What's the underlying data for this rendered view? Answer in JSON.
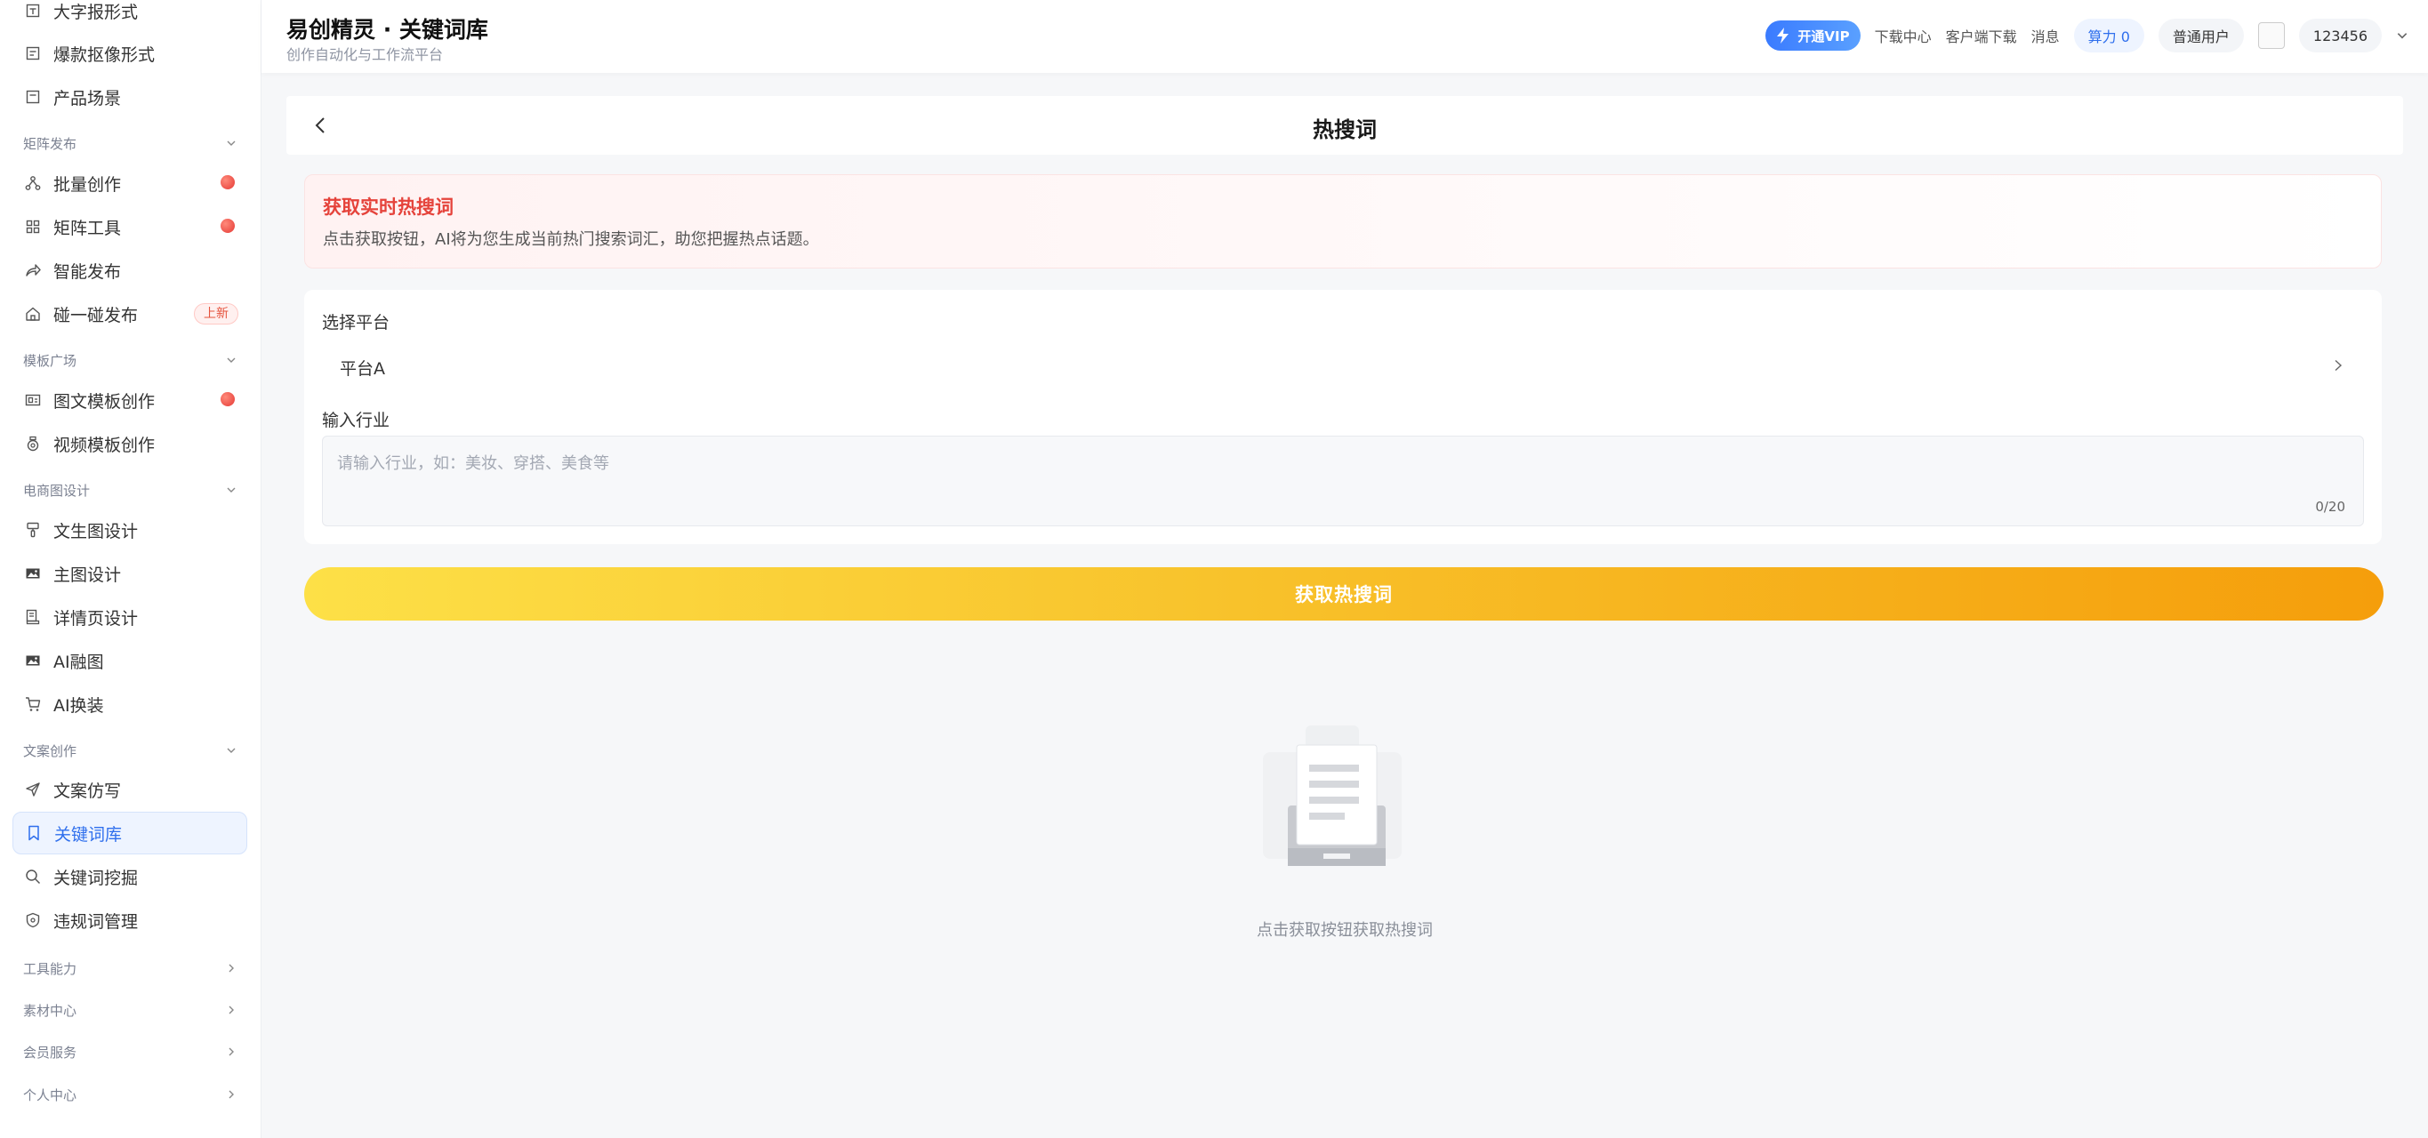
{
  "header": {
    "title": "易创精灵 · 关键词库",
    "subtitle": "创作自动化与工作流平台",
    "vip_label": "开通VIP",
    "download_center": "下载中心",
    "client_download": "客户端下载",
    "messages": "消息",
    "compute": "算力 0",
    "user_type": "普通用户",
    "username": "123456"
  },
  "sidebar": {
    "items_top": [
      {
        "label": "大字报形式",
        "icon": "text-poster-icon"
      },
      {
        "label": "爆款抠像形式",
        "icon": "cutout-icon"
      },
      {
        "label": "产品场景",
        "icon": "scene-icon"
      }
    ],
    "groups": [
      {
        "label": "矩阵发布",
        "expanded": true,
        "items": [
          {
            "label": "批量创作",
            "icon": "sitemap-icon",
            "badge": "hot"
          },
          {
            "label": "矩阵工具",
            "icon": "grid-icon",
            "badge": "hot"
          },
          {
            "label": "智能发布",
            "icon": "share-icon"
          },
          {
            "label": "碰一碰发布",
            "icon": "home-icon",
            "badge_text": "上新"
          }
        ]
      },
      {
        "label": "模板广场",
        "expanded": true,
        "items": [
          {
            "label": "图文模板创作",
            "icon": "image-text-icon",
            "badge": "hot"
          },
          {
            "label": "视频模板创作",
            "icon": "video-template-icon"
          }
        ]
      },
      {
        "label": "电商图设计",
        "expanded": true,
        "items": [
          {
            "label": "文生图设计",
            "icon": "brush-icon"
          },
          {
            "label": "主图设计",
            "icon": "picture-icon"
          },
          {
            "label": "详情页设计",
            "icon": "detail-page-icon"
          },
          {
            "label": "AI融图",
            "icon": "fusion-icon"
          },
          {
            "label": "AI换装",
            "icon": "cart-icon"
          }
        ]
      },
      {
        "label": "文案创作",
        "expanded": true,
        "items": [
          {
            "label": "文案仿写",
            "icon": "send-icon"
          },
          {
            "label": "关键词库",
            "icon": "bookmark-icon",
            "active": true
          },
          {
            "label": "关键词挖掘",
            "icon": "search-icon"
          },
          {
            "label": "违规词管理",
            "icon": "shield-icon"
          }
        ]
      }
    ],
    "collapsed_groups": [
      "工具能力",
      "素材中心",
      "会员服务",
      "个人中心"
    ]
  },
  "main": {
    "page_title": "热搜词",
    "info_title": "获取实时热搜词",
    "info_desc": "点击获取按钮，AI将为您生成当前热门搜索词汇，助您把握热点话题。",
    "platform_label": "选择平台",
    "platform_value": "平台A",
    "industry_label": "输入行业",
    "industry_value": "",
    "industry_placeholder": "请输入行业，如：美妆、穿搭、美食等",
    "counter": "0/20",
    "get_button": "获取热搜词",
    "empty_text": "点击获取按钮获取热搜词"
  },
  "colors": {
    "accent_blue": "#2f6fed",
    "alert_red": "#e5433b",
    "button_gradient_start": "#fde047",
    "button_gradient_end": "#f59e0b"
  }
}
